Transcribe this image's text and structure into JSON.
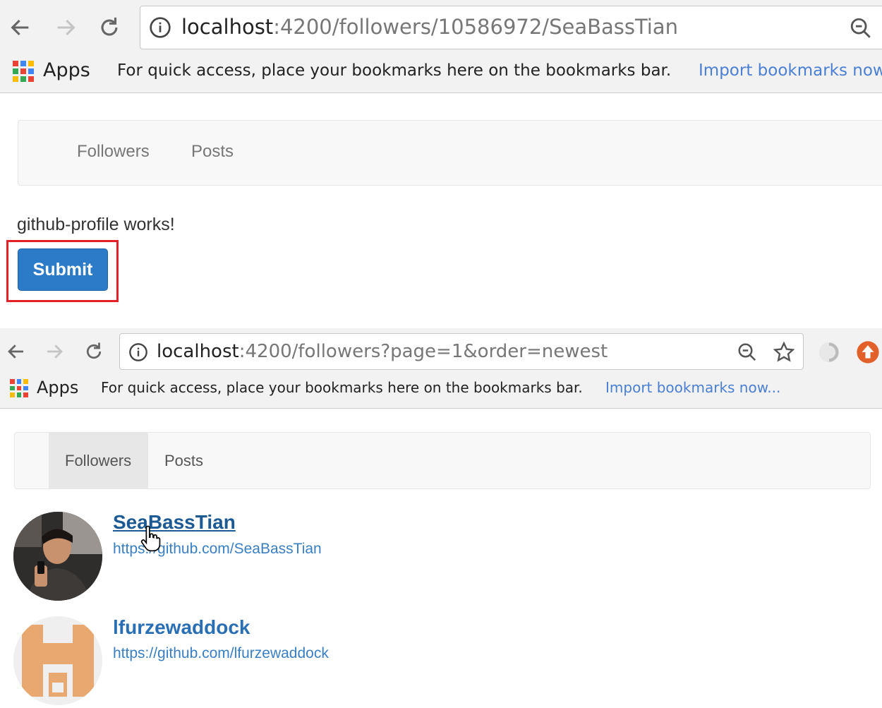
{
  "browser_top": {
    "url_host": "localhost",
    "url_rest": ":4200/followers/10586972/SeaBassTian",
    "bookmarks": {
      "apps_label": "Apps",
      "message": "For quick access, place your bookmarks here on the bookmarks bar.",
      "import_link": "Import bookmarks now..."
    }
  },
  "page1": {
    "nav": {
      "followers": "Followers",
      "posts": "Posts"
    },
    "works_text": "github-profile works!",
    "submit_label": "Submit"
  },
  "browser_second": {
    "url_host": "localhost",
    "url_rest": ":4200/followers?page=1&order=newest",
    "bookmarks": {
      "apps_label": "Apps",
      "message": "For quick access, place your bookmarks here on the bookmarks bar.",
      "import_link": "Import bookmarks now..."
    }
  },
  "page2": {
    "nav": {
      "followers": "Followers",
      "posts": "Posts"
    },
    "followers": [
      {
        "login": "SeaBassTian",
        "url": "https://github.com/SeaBassTian"
      },
      {
        "login": "lfurzewaddock",
        "url": "https://github.com/lfurzewaddock"
      }
    ]
  },
  "colors": {
    "accent_button": "#2b7bc8",
    "highlight": "#e2212a",
    "link": "#2a6fb4",
    "identicon": "#e8a870"
  }
}
